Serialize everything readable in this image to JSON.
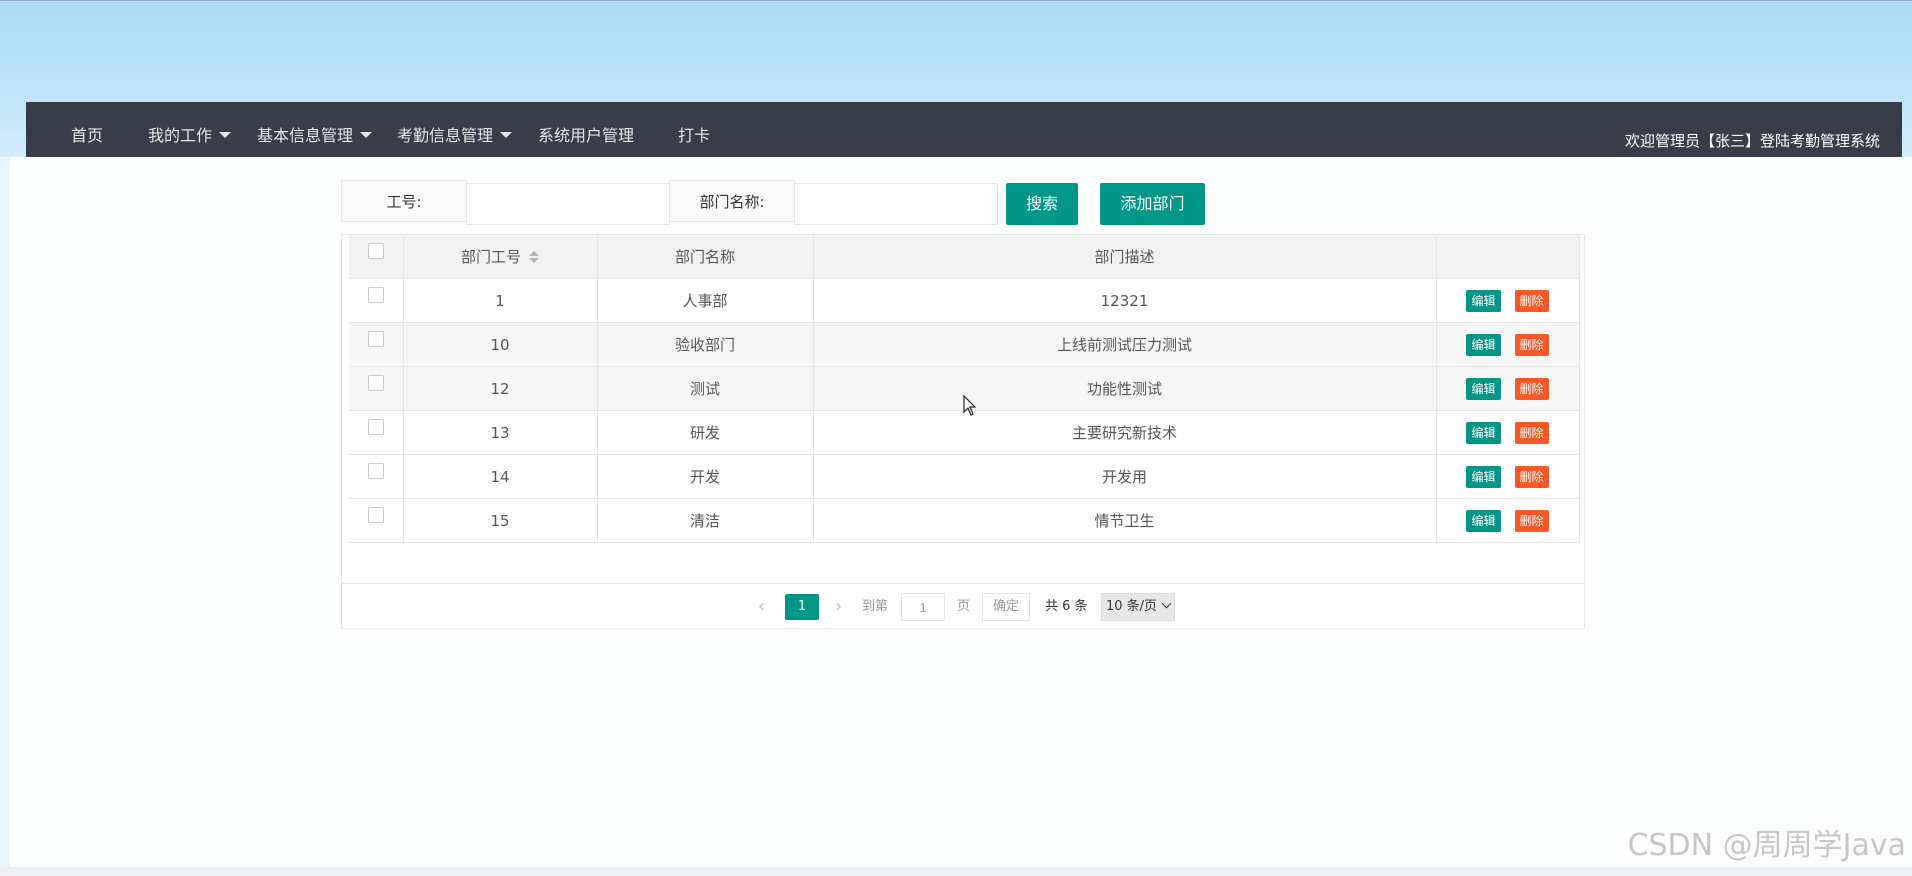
{
  "nav": {
    "items": [
      {
        "label": "首页",
        "dropdown": false
      },
      {
        "label": "我的工作",
        "dropdown": true
      },
      {
        "label": "基本信息管理",
        "dropdown": true
      },
      {
        "label": "考勤信息管理",
        "dropdown": true
      },
      {
        "label": "系统用户管理",
        "dropdown": false
      },
      {
        "label": "打卡",
        "dropdown": false
      }
    ],
    "welcome": "欢迎管理员【张三】登陆考勤管理系统"
  },
  "search": {
    "id_label": "工号:",
    "id_value": "",
    "dept_label": "部门名称:",
    "dept_value": "",
    "search_button": "搜索",
    "add_button": "添加部门"
  },
  "table": {
    "columns": [
      "部门工号",
      "部门名称",
      "部门描述"
    ],
    "edit_label": "编辑",
    "delete_label": "删除",
    "rows": [
      {
        "id": "1",
        "name": "人事部",
        "desc": "12321"
      },
      {
        "id": "10",
        "name": "验收部门",
        "desc": "上线前测试压力测试"
      },
      {
        "id": "12",
        "name": "测试",
        "desc": "功能性测试"
      },
      {
        "id": "13",
        "name": "研发",
        "desc": "主要研究新技术"
      },
      {
        "id": "14",
        "name": "开发",
        "desc": "开发用"
      },
      {
        "id": "15",
        "name": "清洁",
        "desc": "情节卫生"
      }
    ]
  },
  "pager": {
    "current_page": "1",
    "goto_label": "到第",
    "goto_value": "1",
    "page_unit": "页",
    "confirm": "确定",
    "total": "共 6 条",
    "per_page": "10 条/页"
  },
  "watermark": "CSDN @周周学Java",
  "colors": {
    "accent": "#009688",
    "danger": "#ff5722",
    "navbar": "#393d49"
  }
}
